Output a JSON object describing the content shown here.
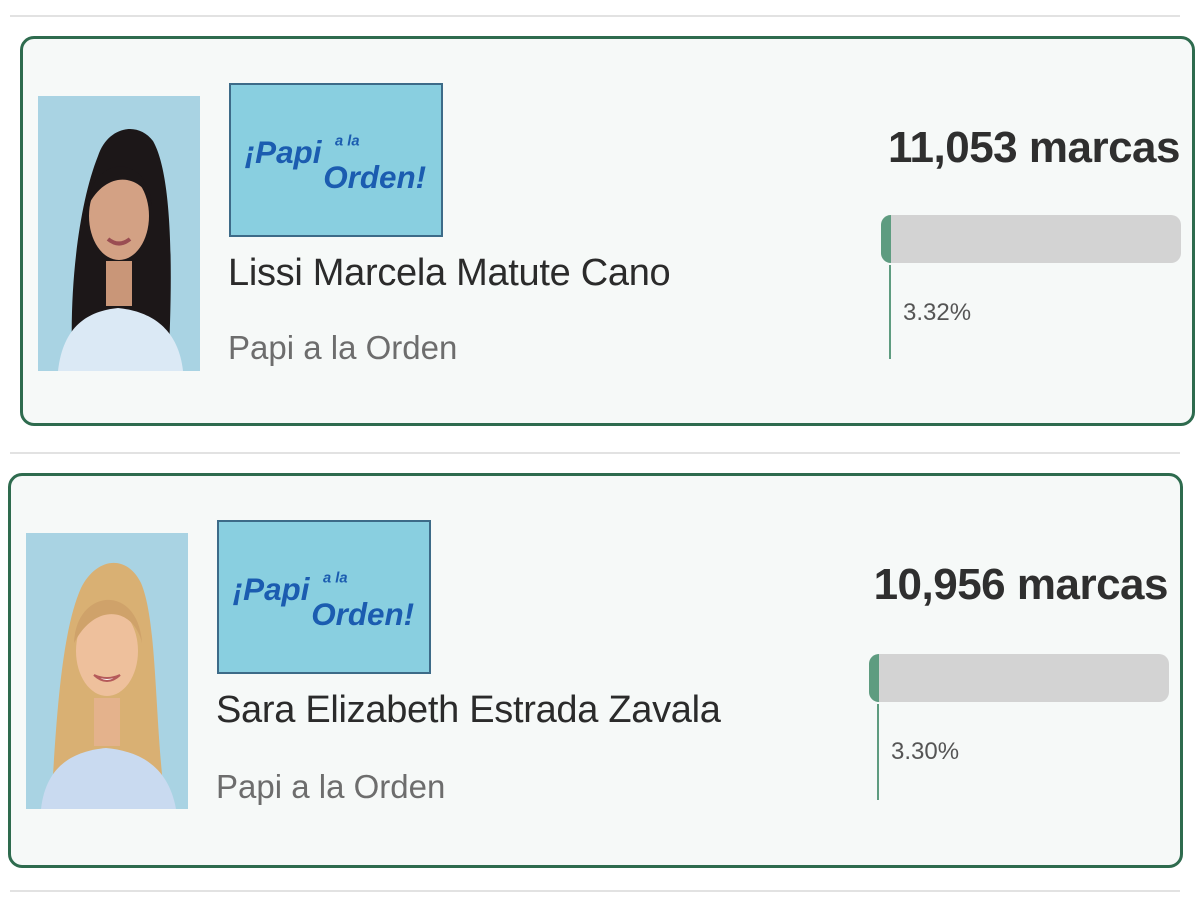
{
  "results": [
    {
      "candidate_name": "Lissi Marcela Matute Cano",
      "party_name": "Papi a la Orden",
      "party_logo_text": "¡Papi a la Orden!",
      "vote_count": "11,053 marcas",
      "percentage_text": "3.32%",
      "percentage_value": 3.32
    },
    {
      "candidate_name": "Sara Elizabeth Estrada Zavala",
      "party_name": "Papi a la Orden",
      "party_logo_text": "¡Papi a la Orden!",
      "vote_count": "10,956 marcas",
      "percentage_text": "3.30%",
      "percentage_value": 3.3
    }
  ],
  "colors": {
    "card_border": "#2e6b4e",
    "bar_fill": "#5e9c80",
    "bar_track": "#d3d3d3",
    "logo_background": "#89cfe0",
    "logo_text": "#1b5cb0"
  }
}
